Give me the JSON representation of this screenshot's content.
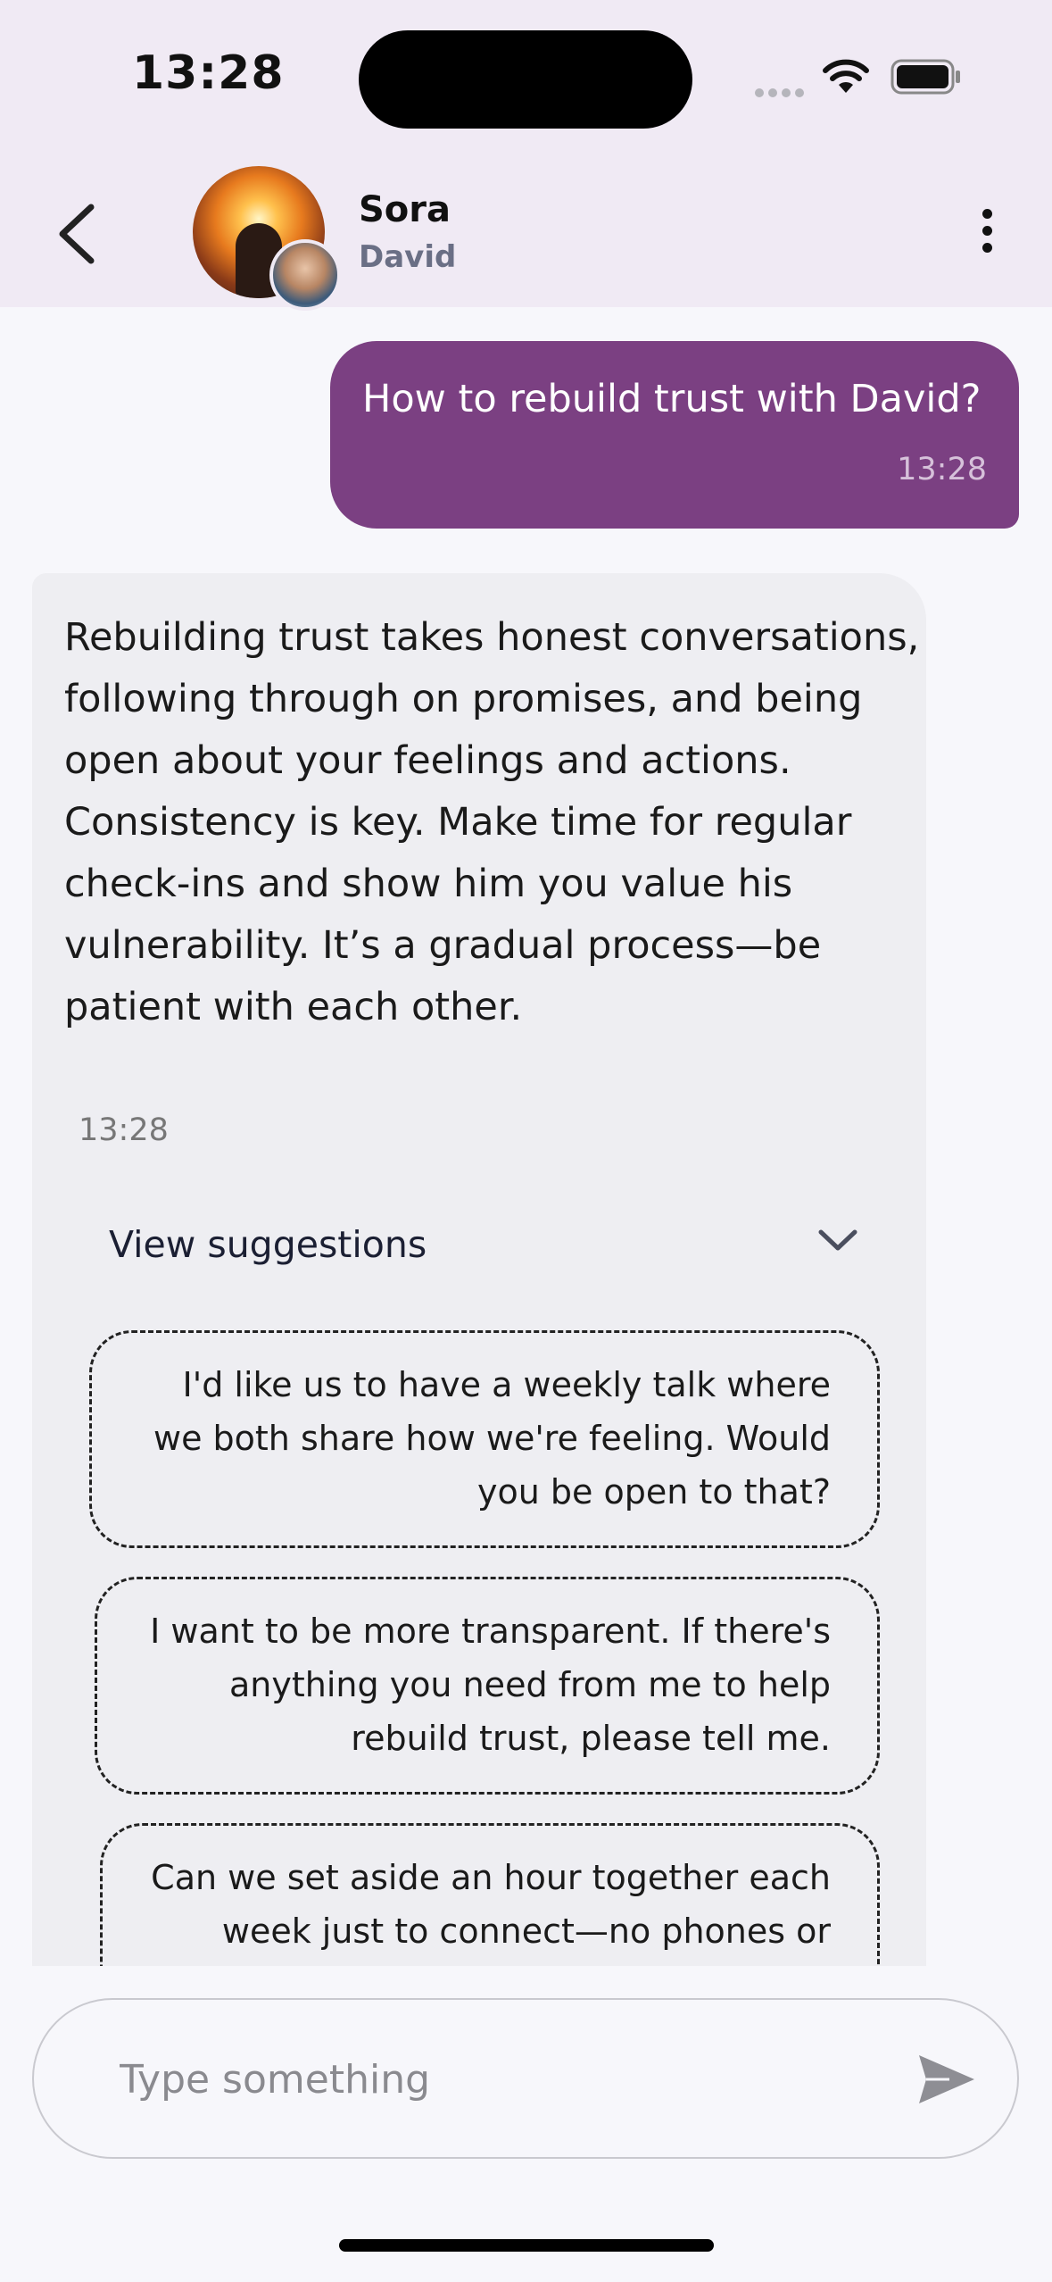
{
  "status_bar": {
    "time": "13:28"
  },
  "header": {
    "title": "Sora",
    "subtitle": "David",
    "icons": {
      "back": "chevron-left-icon",
      "more": "more-vertical-icon"
    }
  },
  "messages": [
    {
      "sender": "user",
      "text": "How to rebuild trust with David?",
      "time": "13:28"
    },
    {
      "sender": "assistant",
      "text": "Rebuilding trust takes honest conversations, following through on promises, and being open about your feelings and actions. Consistency is key. Make time for regular check-ins and show him you value his vulnerability. It’s a gradual process—be patient with each other.",
      "time": "13:28",
      "suggestions_label": "View suggestions",
      "suggestions": [
        "I'd like us to have a weekly talk where we both share how we're feeling. Would you be open to that?",
        "I want to be more transparent. If there's anything you need from me to help rebuild trust, please tell me.",
        "Can we set aside an hour together each week just to connect—no phones or"
      ]
    }
  ],
  "composer": {
    "placeholder": "Type something",
    "value": ""
  },
  "colors": {
    "user_bubble": "#7b4082",
    "assistant_bubble": "#eeeef2",
    "header_bg": "#f0eaf4"
  }
}
